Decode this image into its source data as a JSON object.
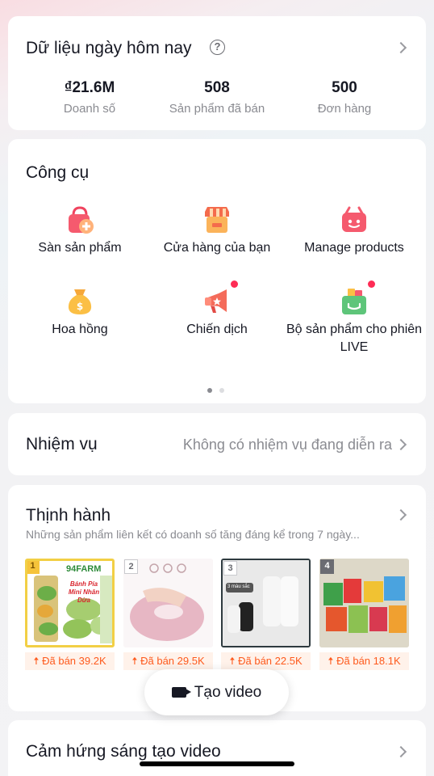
{
  "today": {
    "title": "Dữ liệu ngày hôm nay",
    "help_icon": "?",
    "stats": [
      {
        "value": "₫21.6M",
        "label": "Doanh số"
      },
      {
        "value": "508",
        "label": "Sản phẩm đã bán"
      },
      {
        "value": "500",
        "label": "Đơn hàng"
      }
    ]
  },
  "tools": {
    "title": "Công cụ",
    "items": [
      {
        "label": "Sàn sản phẩm",
        "icon": "shopping-bag-plus-icon",
        "badge": false
      },
      {
        "label": "Cửa hàng của bạn",
        "icon": "storefront-icon",
        "badge": false
      },
      {
        "label": "Manage products",
        "icon": "basket-icon",
        "badge": false
      },
      {
        "label": "Hoa hồng",
        "icon": "money-bag-icon",
        "badge": false
      },
      {
        "label": "Chiến dịch",
        "icon": "megaphone-icon",
        "badge": true
      },
      {
        "label": "Bộ sản phẩm cho phiên LIVE",
        "icon": "product-box-icon",
        "badge": true
      }
    ],
    "pages": 2,
    "current_page": 1
  },
  "tasks": {
    "title": "Nhiệm vụ",
    "status": "Không có nhiệm vụ đang diễn ra"
  },
  "trending": {
    "title": "Thịnh hành",
    "subtitle": "Những sản phẩm liên kết có doanh số tăng đáng kể trong 7 ngày...",
    "products": [
      {
        "rank": "1",
        "sold": "Đã bán 39.2K",
        "brand": "94FARM",
        "name": "Bánh Pía Mini Nhân Dừa"
      },
      {
        "rank": "2",
        "sold": "Đã bán 29.5K"
      },
      {
        "rank": "3",
        "sold": "Đã bán 22.5K",
        "tag": "3 màu sắc"
      },
      {
        "rank": "4",
        "sold": "Đã bán 18.1K"
      }
    ]
  },
  "create_video": {
    "label": "Tạo video",
    "icon": "video-camera-icon"
  },
  "inspiration": {
    "title": "Cảm hứng sáng tạo video"
  },
  "colors": {
    "accent": "#fe2c55",
    "sold": "#fe5a1d",
    "rank_gold": "#f6c33a"
  }
}
